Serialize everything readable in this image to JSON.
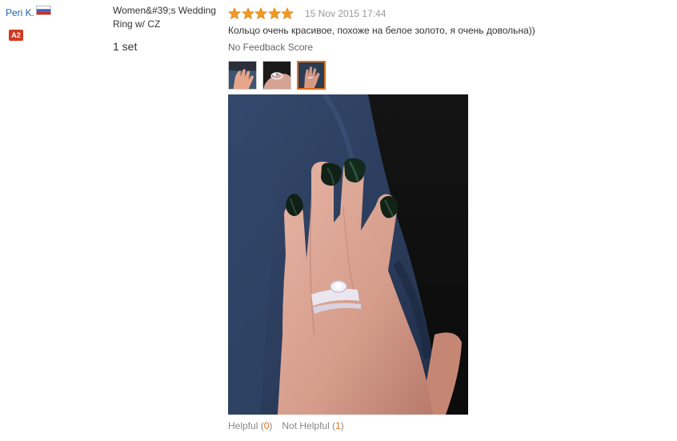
{
  "user": {
    "name": "Peri K.",
    "country_flag": "russia-flag-icon",
    "level_badge": "A2",
    "badge_color": "#d13b22"
  },
  "product": {
    "name": "Women&#39;s Wedding Ring w/ CZ",
    "quantity": "1 set"
  },
  "review": {
    "rating": 5,
    "rating_max": 5,
    "star_color": "#f29a1f",
    "date": "15 Nov 2015 17:44",
    "text": "Кольцо очень красивое, похоже на белое золото, я очень довольна))",
    "feedback_score": "No Feedback Score",
    "thumbnails": [
      "hand-photo-thumbnail",
      "ring-closeup-thumbnail",
      "hand-with-ring-thumbnail"
    ],
    "selected_thumbnail": 2
  },
  "votes": {
    "helpful_label": "Helpful",
    "helpful_open": "(",
    "helpful_count": "0",
    "helpful_close": ")",
    "not_helpful_label": "Not Helpful",
    "not_helpful_open": "(",
    "not_helpful_count": "1",
    "not_helpful_close": ")"
  },
  "colors": {
    "link": "#1d5fa6",
    "accent": "#e0701a",
    "muted": "#999999"
  }
}
